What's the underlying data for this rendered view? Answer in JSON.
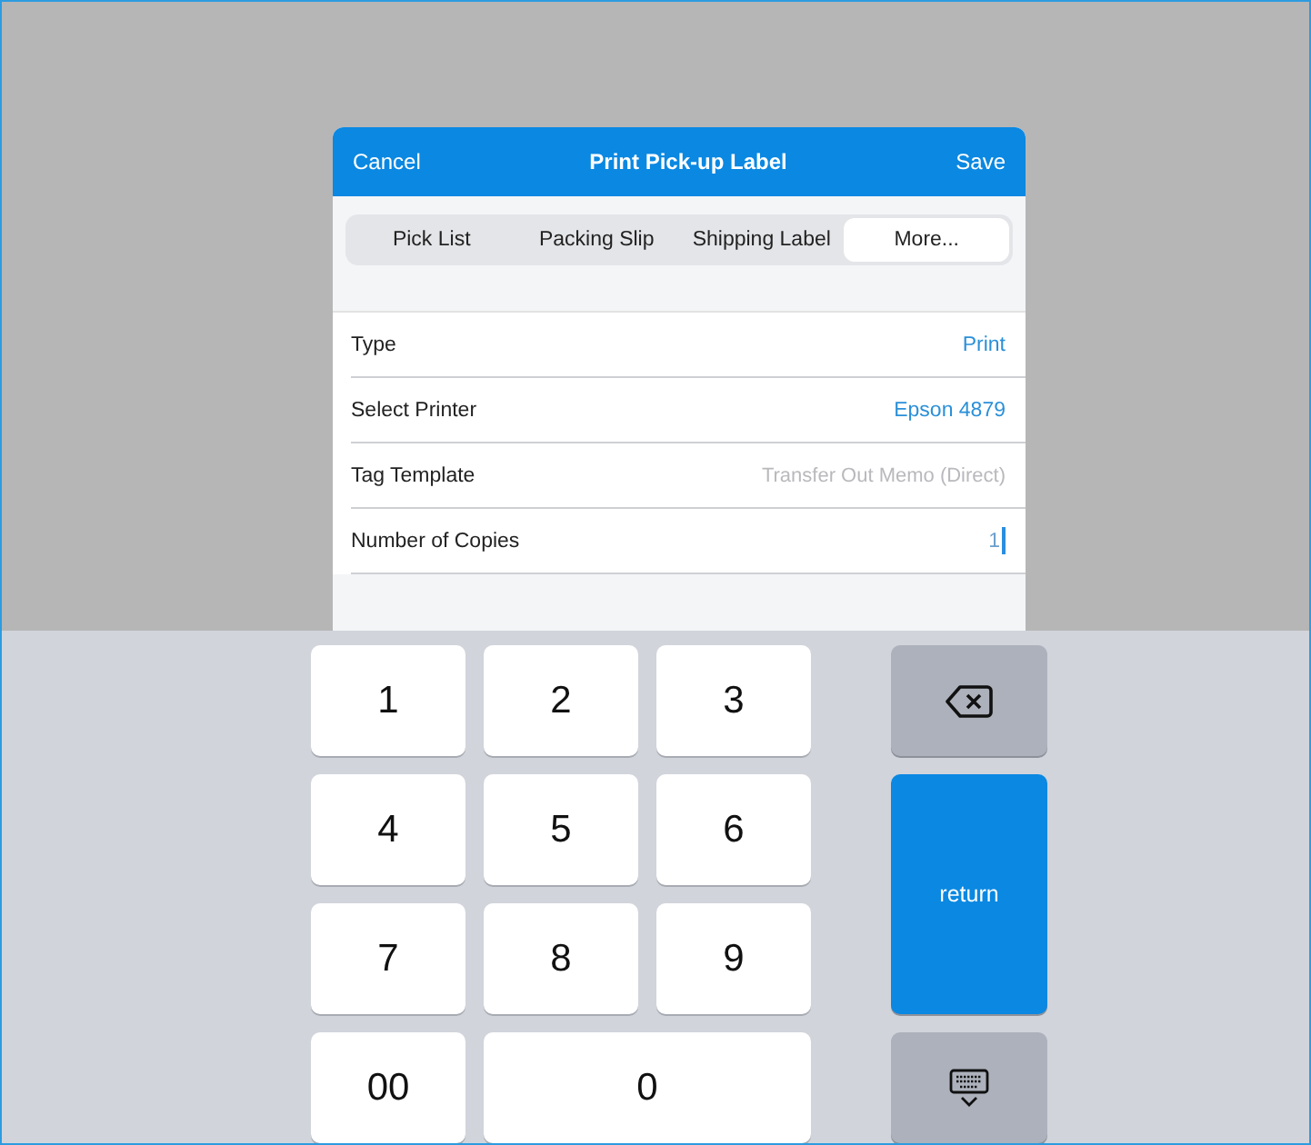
{
  "dialog": {
    "cancel": "Cancel",
    "title": "Print Pick-up Label",
    "save": "Save"
  },
  "segments": [
    {
      "label": "Pick List",
      "selected": false
    },
    {
      "label": "Packing Slip",
      "selected": false
    },
    {
      "label": "Shipping Label",
      "selected": false
    },
    {
      "label": "More...",
      "selected": true
    }
  ],
  "rows": [
    {
      "label": "Type",
      "value": "Print",
      "kind": "link"
    },
    {
      "label": "Select Printer",
      "value": "Epson 4879",
      "kind": "link"
    },
    {
      "label": "Tag Template",
      "placeholder": "Transfer Out Memo (Direct)",
      "kind": "placeholder"
    },
    {
      "label": "Number of Copies",
      "value": "1",
      "kind": "input"
    }
  ],
  "numpad": [
    {
      "label": "1",
      "kind": "digit"
    },
    {
      "label": "2",
      "kind": "digit"
    },
    {
      "label": "3",
      "kind": "digit"
    },
    {
      "label": "4",
      "kind": "digit"
    },
    {
      "label": "5",
      "kind": "digit"
    },
    {
      "label": "6",
      "kind": "digit"
    },
    {
      "label": "7",
      "kind": "digit"
    },
    {
      "label": "8",
      "kind": "digit"
    },
    {
      "label": "9",
      "kind": "digit"
    },
    {
      "label": "00",
      "kind": "digit"
    },
    {
      "label": "0",
      "kind": "wide"
    }
  ],
  "function_keys": [
    {
      "kind": "delete"
    },
    {
      "kind": "return",
      "label": "return"
    },
    {
      "kind": "dismiss"
    }
  ]
}
